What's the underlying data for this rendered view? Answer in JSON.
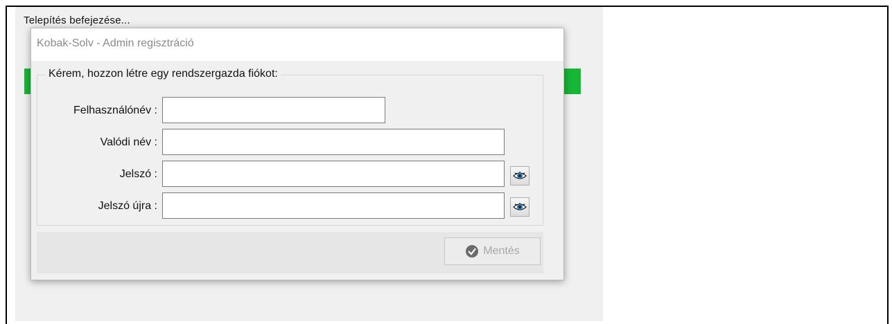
{
  "install": {
    "title": "Telepítés befejezése..."
  },
  "dialog": {
    "title": "Kobak-Solv - Admin regisztráció",
    "group_label": "Kérem, hozzon létre egy rendszergazda fiókot:",
    "fields": {
      "username": {
        "label": "Felhasználónév :",
        "value": ""
      },
      "realname": {
        "label": "Valódi név :",
        "value": ""
      },
      "password": {
        "label": "Jelszó :",
        "value": ""
      },
      "password_again": {
        "label": "Jelszó újra :",
        "value": ""
      }
    },
    "save_label": "Mentés"
  },
  "colors": {
    "progress": "#16b736",
    "dialog_title_text": "#8a8a8a"
  },
  "icons": {
    "show_password": "eye-icon",
    "save": "check-circle-icon"
  }
}
